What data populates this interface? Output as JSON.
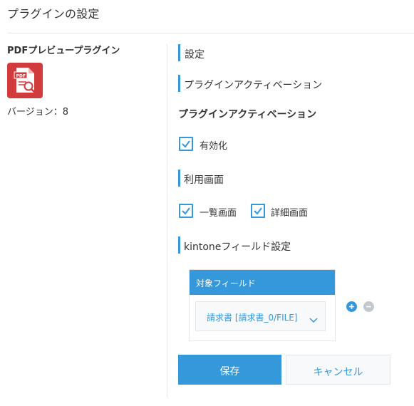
{
  "page": {
    "title": "プラグインの設定"
  },
  "plugin": {
    "name": "PDFプレビュープラグイン",
    "icon": "pdf-preview-icon",
    "icon_color": "#d23b3b",
    "version_label": "バージョン：8"
  },
  "settings": {
    "heading": "設定",
    "activation_section": "プラグインアクティベーション",
    "activation_title": "プラグインアクティベーション",
    "enabled_label": "有効化",
    "enabled_checked": true,
    "usage_section": "利用画面",
    "list_view_label": "一覧画面",
    "list_view_checked": true,
    "detail_view_label": "詳細画面",
    "detail_view_checked": true,
    "field_section": "kintoneフィールド設定",
    "field_table_header": "対象フィールド",
    "field_selected": "請求書 [請求書_0/FILE]"
  },
  "actions": {
    "save_label": "保存",
    "cancel_label": "キャンセル"
  },
  "colors": {
    "accent": "#3498db",
    "border": "#e3e7e8",
    "text": "#333333",
    "add_button": "#3498db",
    "remove_button": "#c3c8cc"
  }
}
